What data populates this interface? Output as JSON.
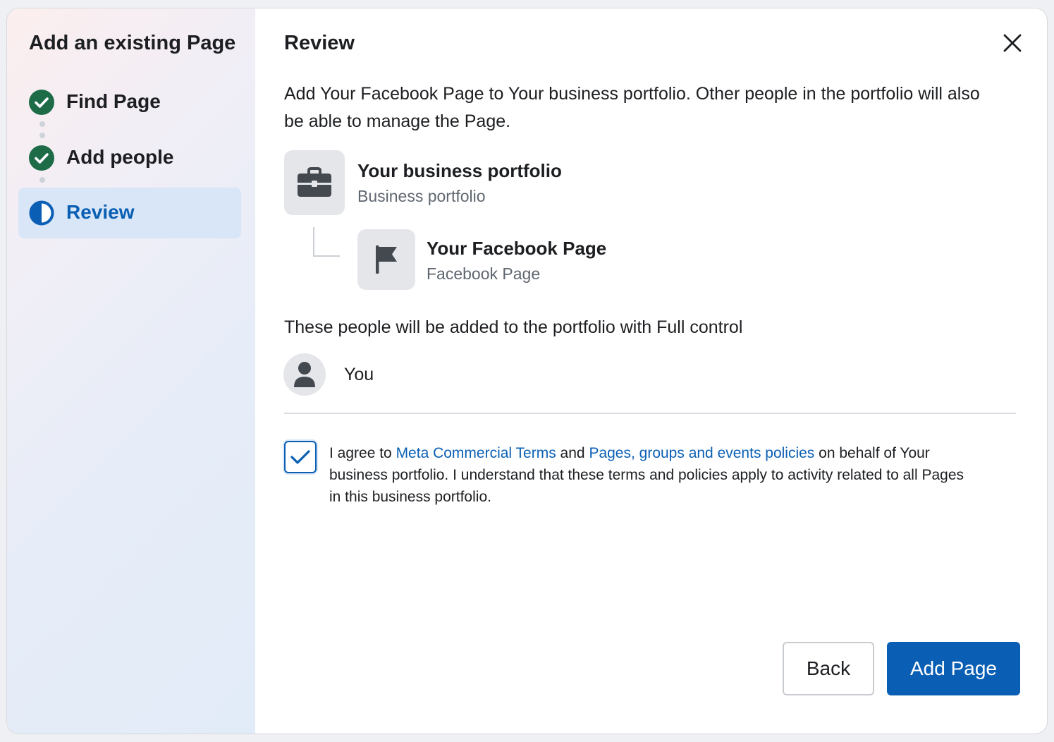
{
  "sidebar": {
    "title": "Add an existing Page",
    "steps": [
      {
        "label": "Find Page",
        "status": "complete",
        "icon": "check-circle-icon"
      },
      {
        "label": "Add people",
        "status": "complete",
        "icon": "check-circle-icon"
      },
      {
        "label": "Review",
        "status": "active",
        "icon": "half-circle-icon"
      }
    ]
  },
  "main": {
    "title": "Review",
    "description": "Add Your Facebook Page to Your business portfolio. Other people in the portfolio will also be able to manage the Page.",
    "portfolio": {
      "name": "Your business portfolio",
      "type": "Business portfolio",
      "icon": "briefcase-icon"
    },
    "page": {
      "name": "Your Facebook Page",
      "type": "Facebook Page",
      "icon": "flag-icon"
    },
    "people_heading": "These people will be added to the portfolio with Full control",
    "people": [
      {
        "name": "You",
        "icon": "person-icon"
      }
    ],
    "agreement": {
      "checked": true,
      "prefix": "I agree to ",
      "link1": "Meta Commercial Terms",
      "middle": " and ",
      "link2": "Pages, groups and events policies",
      "suffix": " on behalf of Your business portfolio. I understand that these terms and policies apply to activity related to all Pages in this business portfolio."
    }
  },
  "buttons": {
    "back": "Back",
    "primary": "Add Page"
  },
  "colors": {
    "accent": "#0a5fb4",
    "success": "#1e6b47",
    "active_step_bg": "#d8e6f7"
  }
}
